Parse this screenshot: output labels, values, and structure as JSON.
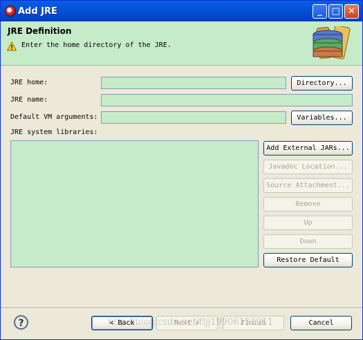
{
  "window": {
    "title": "Add JRE",
    "minimize": "_",
    "maximize": "□",
    "close": "✕"
  },
  "header": {
    "title": "JRE Definition",
    "message": "Enter the home directory of the JRE."
  },
  "form": {
    "jre_home_label": "JRE home:",
    "jre_home_value": "",
    "jre_name_label": "JRE name:",
    "jre_name_value": "",
    "vm_args_label": "Default VM arguments:",
    "vm_args_value": "",
    "libraries_label": "JRE system libraries:",
    "directory_button": "Directory...",
    "variables_button": "Variables..."
  },
  "library_buttons": {
    "add_external_jars": "Add External JARs...",
    "javadoc_location": "Javadoc Location...",
    "source_attachment": "Source Attachment...",
    "remove": "Remove",
    "up": "Up",
    "down": "Down",
    "restore_default": "Restore Default"
  },
  "footer": {
    "help": "?",
    "back": "< Back",
    "next": "Next >",
    "finish": "Finish",
    "cancel": "Cancel",
    "watermark": "http://blog.csdn.net/tljj19906151011"
  },
  "colors": {
    "title_bar": "#0453d6",
    "header_bg": "#c6ebc9",
    "field_bg": "#c6ebc9",
    "dialog_bg": "#ece9d8"
  }
}
